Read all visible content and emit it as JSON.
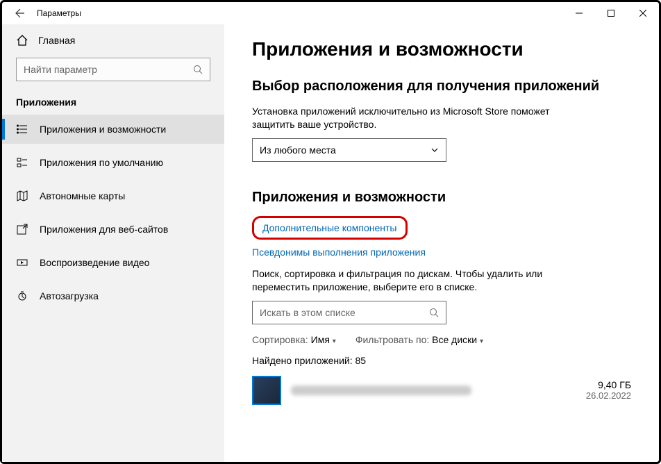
{
  "window": {
    "title": "Параметры"
  },
  "sidebar": {
    "home": "Главная",
    "search_placeholder": "Найти параметр",
    "section": "Приложения",
    "items": [
      {
        "label": "Приложения и возможности"
      },
      {
        "label": "Приложения по умолчанию"
      },
      {
        "label": "Автономные карты"
      },
      {
        "label": "Приложения для веб-сайтов"
      },
      {
        "label": "Воспроизведение видео"
      },
      {
        "label": "Автозагрузка"
      }
    ]
  },
  "main": {
    "h1": "Приложения и возможности",
    "source": {
      "h2": "Выбор расположения для получения приложений",
      "desc": "Установка приложений исключительно из Microsoft Store поможет защитить ваше устройство.",
      "select_value": "Из любого места"
    },
    "apps": {
      "h2": "Приложения и возможности",
      "link_optional": "Дополнительные компоненты",
      "link_alias": "Псевдонимы выполнения приложения",
      "desc": "Поиск, сортировка и фильтрация по дискам. Чтобы удалить или переместить приложение, выберите его в списке.",
      "search_placeholder": "Искать в этом списке",
      "sort_label": "Сортировка:",
      "sort_value": "Имя",
      "filter_label": "Фильтровать по:",
      "filter_value": "Все диски",
      "count": "Найдено приложений: 85",
      "first_app": {
        "size": "9,40 ГБ",
        "date": "26.02.2022"
      }
    }
  }
}
